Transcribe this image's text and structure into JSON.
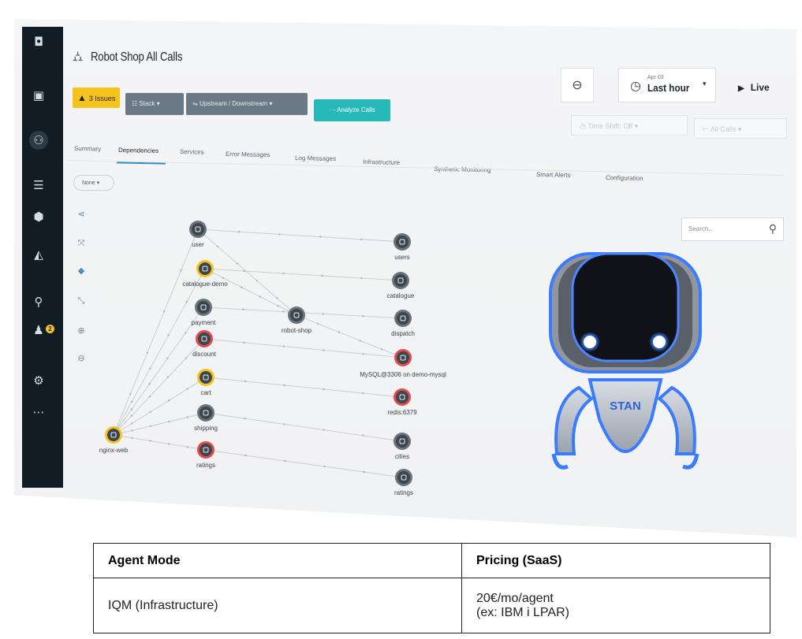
{
  "app": {
    "title": "Robot Shop All Calls"
  },
  "toolbar": {
    "issues_label": "3 Issues",
    "stack_label": "Stack",
    "upstream_label": "Upstream / Downstream",
    "analyze_label": "Analyze Calls",
    "time_date": "Apr 03",
    "time_range": "Last hour",
    "live_label": "Live",
    "time_shift_label": "Time Shift: Off",
    "all_calls_label": "All Calls"
  },
  "tabs": [
    {
      "label": "Summary"
    },
    {
      "label": "Dependencies",
      "active": true
    },
    {
      "label": "Services"
    },
    {
      "label": "Error Messages"
    },
    {
      "label": "Log Messages"
    },
    {
      "label": "Infrastructure"
    },
    {
      "label": "Synthetic Monitoring"
    },
    {
      "label": "Smart Alerts"
    },
    {
      "label": "Configuration"
    }
  ],
  "group_by": {
    "label": "None"
  },
  "search": {
    "placeholder": "Search..."
  },
  "graph": {
    "nodes": [
      {
        "id": "nginx-web",
        "label": "nginx-web",
        "status": "warning"
      },
      {
        "id": "user",
        "label": "user",
        "status": "ok"
      },
      {
        "id": "catalogue-demo",
        "label": "catalogue-demo",
        "status": "warning"
      },
      {
        "id": "payment",
        "label": "payment",
        "status": "ok"
      },
      {
        "id": "discount",
        "label": "discount",
        "status": "error"
      },
      {
        "id": "cart",
        "label": "cart",
        "status": "warning"
      },
      {
        "id": "shipping",
        "label": "shipping",
        "status": "ok"
      },
      {
        "id": "ratings-svc",
        "label": "ratings",
        "status": "error"
      },
      {
        "id": "robot-shop",
        "label": "robot-shop",
        "status": "ok"
      },
      {
        "id": "users",
        "label": "users",
        "status": "ok"
      },
      {
        "id": "catalogue",
        "label": "catalogue",
        "status": "ok"
      },
      {
        "id": "dispatch",
        "label": "dispatch",
        "status": "ok"
      },
      {
        "id": "mysql",
        "label": "MySQL@3306 on demo-mysql",
        "status": "error"
      },
      {
        "id": "redis",
        "label": "redis:6379",
        "status": "error"
      },
      {
        "id": "cities",
        "label": "cities",
        "status": "ok"
      },
      {
        "id": "ratings-db",
        "label": "ratings",
        "status": "ok"
      }
    ],
    "edges": [
      [
        "nginx-web",
        "user"
      ],
      [
        "nginx-web",
        "catalogue-demo"
      ],
      [
        "nginx-web",
        "payment"
      ],
      [
        "nginx-web",
        "discount"
      ],
      [
        "nginx-web",
        "cart"
      ],
      [
        "nginx-web",
        "shipping"
      ],
      [
        "nginx-web",
        "ratings-svc"
      ],
      [
        "user",
        "users"
      ],
      [
        "user",
        "robot-shop"
      ],
      [
        "catalogue-demo",
        "catalogue"
      ],
      [
        "payment",
        "dispatch"
      ],
      [
        "discount",
        "mysql"
      ],
      [
        "cart",
        "redis"
      ],
      [
        "shipping",
        "cities"
      ],
      [
        "ratings-svc",
        "ratings-db"
      ],
      [
        "robot-shop",
        "mysql"
      ],
      [
        "catalogue-demo",
        "robot-shop"
      ]
    ]
  },
  "mascot": {
    "label": "STAN"
  },
  "pricing": {
    "headers": [
      "Agent Mode",
      "Pricing (SaaS)"
    ],
    "rows": [
      {
        "mode": "IQM (Infrastructure)",
        "price": "20€/mo/agent",
        "note": "(ex: IBM i LPAR)"
      }
    ]
  },
  "colors": {
    "accent": "#27b9b9",
    "warning": "#f6c31c",
    "error": "#e24b4b",
    "node": "#3c464f",
    "nav": "#121c24"
  }
}
